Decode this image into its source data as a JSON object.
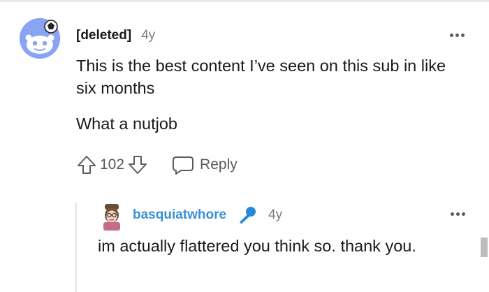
{
  "comment": {
    "author": "[deleted]",
    "age": "4y",
    "paragraphs": [
      "This is the best content I’ve seen on this sub in like six months",
      "What a nutjob"
    ],
    "score": "102",
    "reply_label": "Reply",
    "avatar_icon": "snoo-avatar-icon"
  },
  "reply": {
    "author": "basquiatwhore",
    "age": "4y",
    "flair_icon": "microphone-icon",
    "text": "im actually flattered you think so. thank you.",
    "author_color": "#3a8fd6"
  },
  "colors": {
    "avatar_bg": "#8aa4f4",
    "meta_text": "#7c7c7c",
    "icon_gray": "#5c5c5c"
  }
}
